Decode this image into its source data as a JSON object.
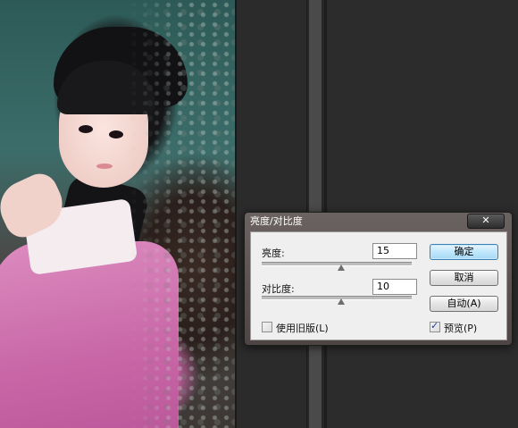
{
  "dialog": {
    "title": "亮度/对比度",
    "close_glyph": "✕",
    "brightness": {
      "label": "亮度:",
      "value": "15",
      "level": 0.53
    },
    "contrast": {
      "label": "对比度:",
      "value": "10",
      "level": 0.53
    },
    "buttons": {
      "ok": "确定",
      "cancel": "取消",
      "auto": "自动(A)"
    },
    "use_legacy": {
      "label": "使用旧版(L)",
      "checked": false
    },
    "preview": {
      "label": "预览(P)",
      "checked": true,
      "mark": "✓"
    }
  },
  "colors": {
    "dialog_frame": "#5c5453",
    "primary_button": "#a7d9f5",
    "workspace": "#2b2b2b"
  }
}
